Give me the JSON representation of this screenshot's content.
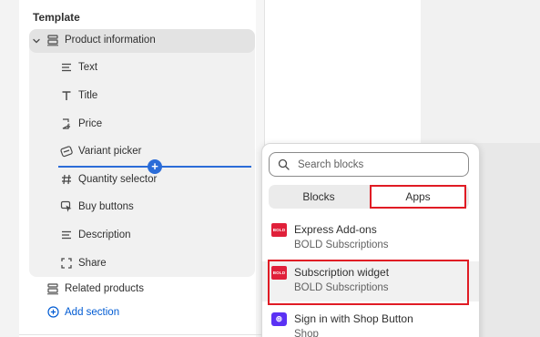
{
  "sidebar": {
    "template_title": "Template",
    "group_label": "Product information",
    "blocks": [
      {
        "label": "Text",
        "icon": "text-lines-icon"
      },
      {
        "label": "Title",
        "icon": "title-t-icon"
      },
      {
        "label": "Price",
        "icon": "price-tag-icon"
      },
      {
        "label": "Variant picker",
        "icon": "variant-picker-icon"
      },
      {
        "label": "Quantity selector",
        "icon": "hash-icon"
      },
      {
        "label": "Buy buttons",
        "icon": "cursor-click-icon"
      },
      {
        "label": "Description",
        "icon": "text-lines-icon"
      },
      {
        "label": "Share",
        "icon": "share-frame-icon"
      }
    ],
    "related_label": "Related products",
    "add_section_label": "Add section",
    "add_icon": "+"
  },
  "popover": {
    "search_placeholder": "Search blocks",
    "tabs": {
      "blocks": "Blocks",
      "apps": "Apps"
    },
    "apps": [
      {
        "name": "Express Add-ons",
        "vendor": "BOLD Subscriptions",
        "logo_text": "BOLD"
      },
      {
        "name": "Subscription widget",
        "vendor": "BOLD Subscriptions",
        "logo_text": "BOLD"
      },
      {
        "name": "Sign in with Shop Button",
        "vendor": "Shop",
        "logo_text": "⊚"
      }
    ]
  },
  "colors": {
    "accent_blue": "#2b6cd8",
    "link_blue": "#005bd3",
    "highlight_red": "#e01b24",
    "bold_brand": "#e0203a",
    "shop_brand": "#5a31f4"
  }
}
